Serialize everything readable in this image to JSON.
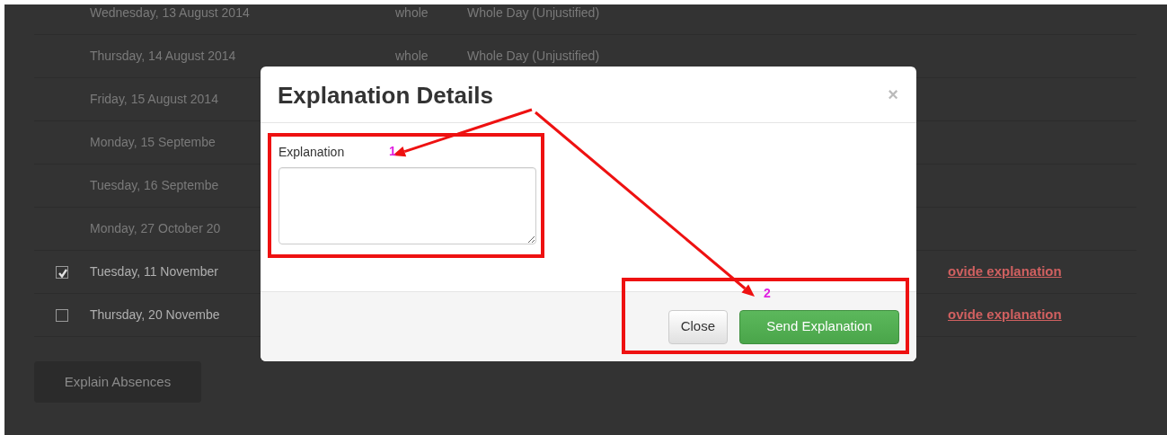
{
  "page": {
    "rows": [
      {
        "kind": "plain",
        "date": "Wednesday, 13 August 2014",
        "part": "whole",
        "type": "Whole Day (Unjustified)"
      },
      {
        "kind": "plain",
        "date": "Thursday, 14 August 2014",
        "part": "whole",
        "type": "Whole Day (Unjustified)"
      },
      {
        "kind": "plain",
        "date": "Friday, 15 August 2014"
      },
      {
        "kind": "plain",
        "date": "Monday, 15 Septembe"
      },
      {
        "kind": "plain",
        "date": "Tuesday, 16 Septembe"
      },
      {
        "kind": "plain",
        "date": "Monday, 27 October 20"
      },
      {
        "kind": "checkable",
        "checked": true,
        "date": "Tuesday, 11 November",
        "action": "ovide explanation"
      },
      {
        "kind": "checkable",
        "checked": false,
        "date": "Thursday, 20 Novembe",
        "action": "ovide explanation"
      }
    ],
    "explain_button": "Explain Absences"
  },
  "modal": {
    "title": "Explanation Details",
    "close_symbol": "×",
    "field_label": "Explanation",
    "buttons": [
      {
        "kind": "default",
        "label": "Close"
      },
      {
        "kind": "success",
        "label": "Send Explanation"
      }
    ]
  },
  "annotations": [
    {
      "number": "1"
    },
    {
      "number": "2"
    }
  ]
}
